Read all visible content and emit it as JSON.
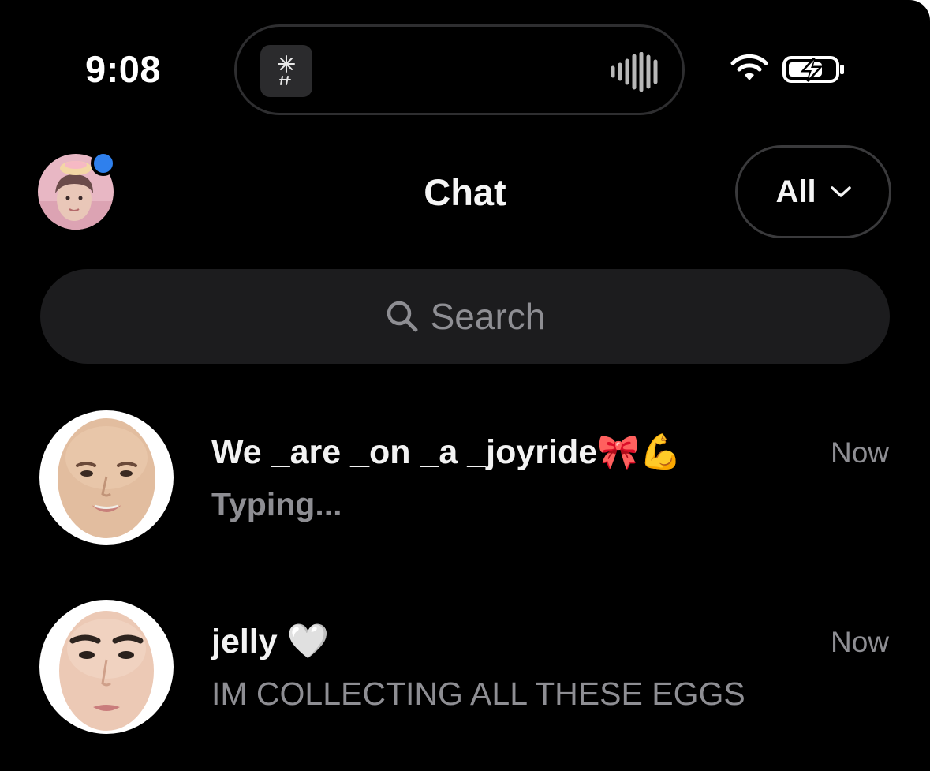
{
  "status_bar": {
    "time": "9:08",
    "icons": [
      "wifi-icon",
      "battery-charging-icon",
      "audio-wave-icon"
    ]
  },
  "header": {
    "title": "Chat",
    "filter": {
      "label": "All",
      "icon": "chevron-down-icon"
    },
    "profile": {
      "icon": "avatar",
      "has_unread_dot": true,
      "dot_color": "#2f80ed"
    }
  },
  "search": {
    "placeholder": "Search",
    "icon": "search-icon"
  },
  "chats": [
    {
      "name": "We _are _on _a _joyride🎀💪",
      "preview": "Typing...",
      "time": "Now"
    },
    {
      "name": "jelly 🤍",
      "preview": "IM COLLECTING ALL THESE EGGS",
      "time": "Now"
    }
  ],
  "colors": {
    "background": "#000000",
    "search_field": "#1c1c1e",
    "secondary_text": "#8e8e93",
    "accent": "#2f80ed"
  }
}
